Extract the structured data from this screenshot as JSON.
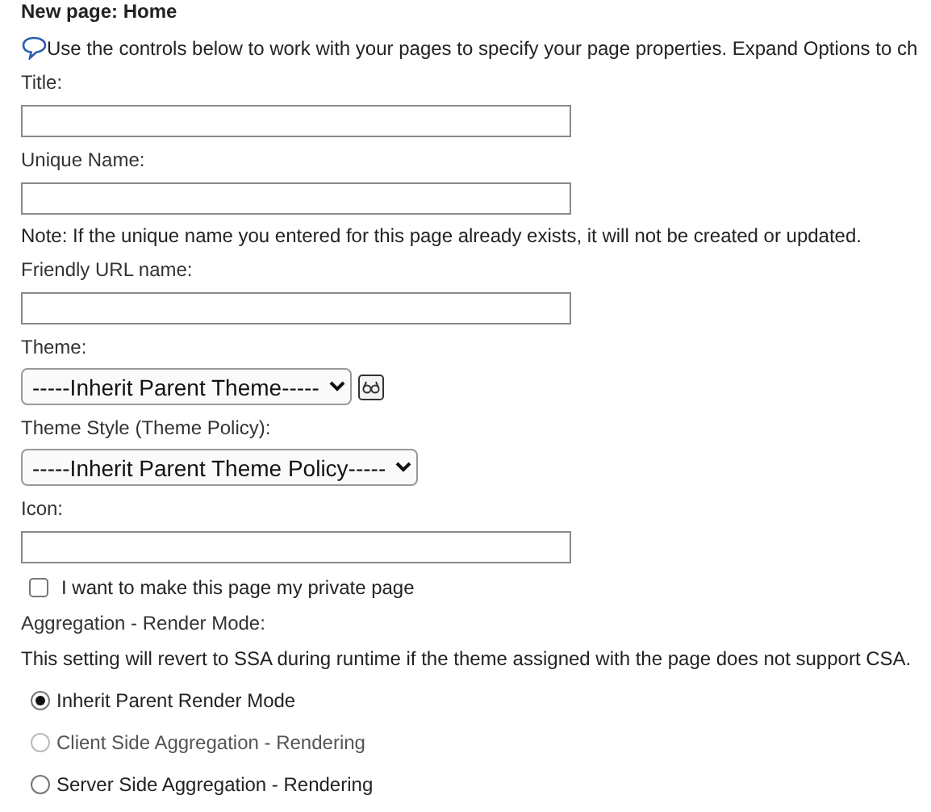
{
  "heading": "New page: Home",
  "info": "Use the controls below to work with your pages to specify your page properties. Expand Options to ch",
  "fields": [
    {
      "kind": "text",
      "label": "Title:"
    },
    {
      "kind": "text",
      "label": "Unique Name:",
      "note": "Note: If the unique name you entered for this page already exists, it will not be created or updated."
    },
    {
      "kind": "text",
      "label": "Friendly URL name:"
    },
    {
      "kind": "select",
      "label": "Theme:",
      "value": "-----Inherit Parent Theme-----",
      "preview_button": true
    },
    {
      "kind": "select",
      "label": "Theme Style (Theme Policy):",
      "value": "-----Inherit Parent Theme Policy-----"
    },
    {
      "kind": "text",
      "label": "Icon:"
    }
  ],
  "private_page": {
    "label": "I want to make this page my private page",
    "checked": false
  },
  "render_mode": {
    "label": "Aggregation - Render Mode:",
    "note": "This setting will revert to SSA during runtime if the theme assigned with the page does not support CSA.",
    "options": [
      {
        "label": "Inherit Parent Render Mode",
        "selected": true,
        "disabled": false
      },
      {
        "label": "Client Side Aggregation - Rendering",
        "selected": false,
        "disabled": true
      },
      {
        "label": "Server Side Aggregation - Rendering",
        "selected": false,
        "disabled": false
      }
    ]
  }
}
